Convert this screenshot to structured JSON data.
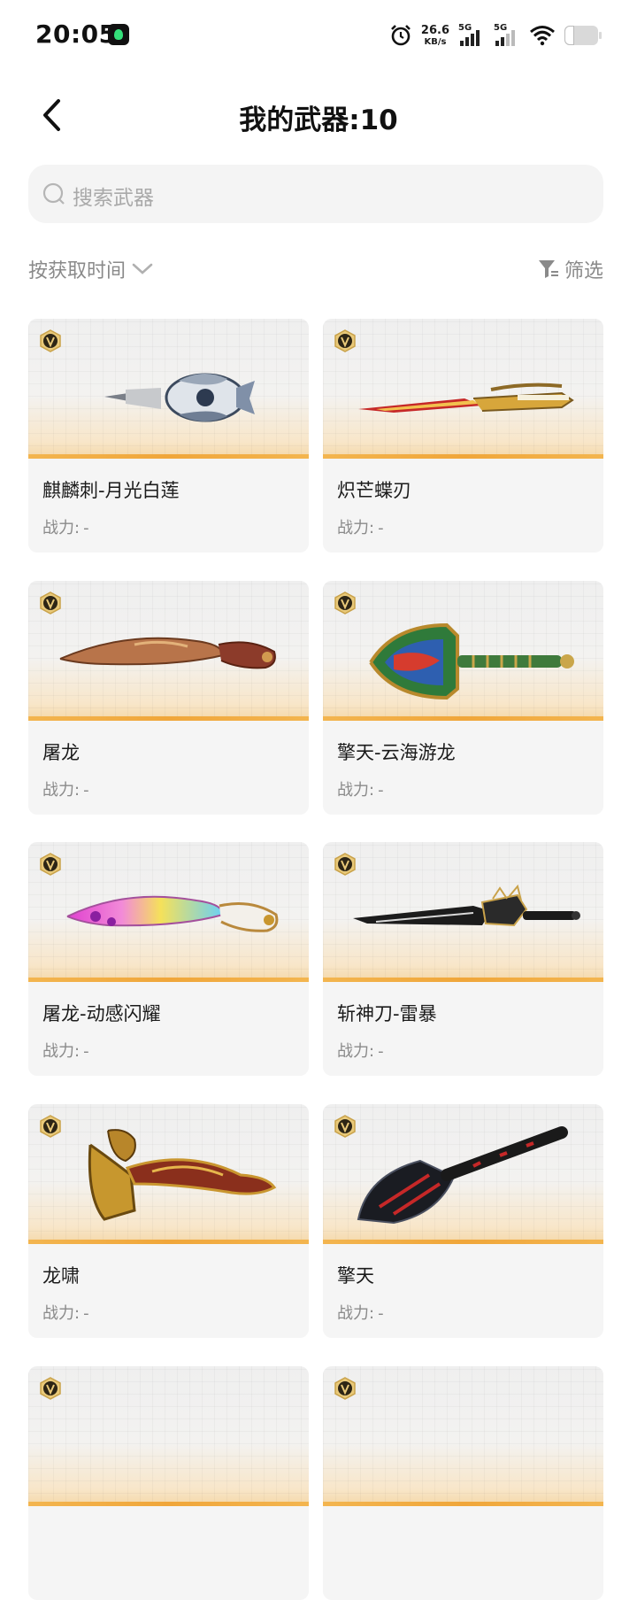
{
  "status_bar": {
    "time": "20:05",
    "speed_value": "26.6",
    "speed_unit": "KB/s",
    "signal1_label": "5G",
    "signal2_label": "5G"
  },
  "header": {
    "title": "我的武器:10"
  },
  "search": {
    "placeholder": "搜索武器"
  },
  "toolbar": {
    "sort_label": "按获取时间",
    "filter_label": "筛选"
  },
  "power_label": "战力:",
  "weapons": [
    {
      "name": "麒麟刺-月光白莲",
      "power": "-",
      "icon": "claw-blade-icon"
    },
    {
      "name": "炽芒蝶刃",
      "power": "-",
      "icon": "butterfly-blade-icon"
    },
    {
      "name": "屠龙",
      "power": "-",
      "icon": "kukri-blade-icon"
    },
    {
      "name": "擎天-云海游龙",
      "power": "-",
      "icon": "shovel-blade-icon"
    },
    {
      "name": "屠龙-动感闪耀",
      "power": "-",
      "icon": "kukri-blade-icon"
    },
    {
      "name": "斩神刀-雷暴",
      "power": "-",
      "icon": "long-saber-icon"
    },
    {
      "name": "龙啸",
      "power": "-",
      "icon": "dragon-axe-icon"
    },
    {
      "name": "擎天",
      "power": "-",
      "icon": "shovel-blade-icon"
    },
    {
      "name": "",
      "power": "",
      "icon": "weapon-icon"
    },
    {
      "name": "",
      "power": "",
      "icon": "weapon-icon"
    }
  ],
  "colors": {
    "accent_orange": "#f0a63a",
    "badge_gold": "#c9a24a",
    "card_bg": "#f5f5f5"
  }
}
